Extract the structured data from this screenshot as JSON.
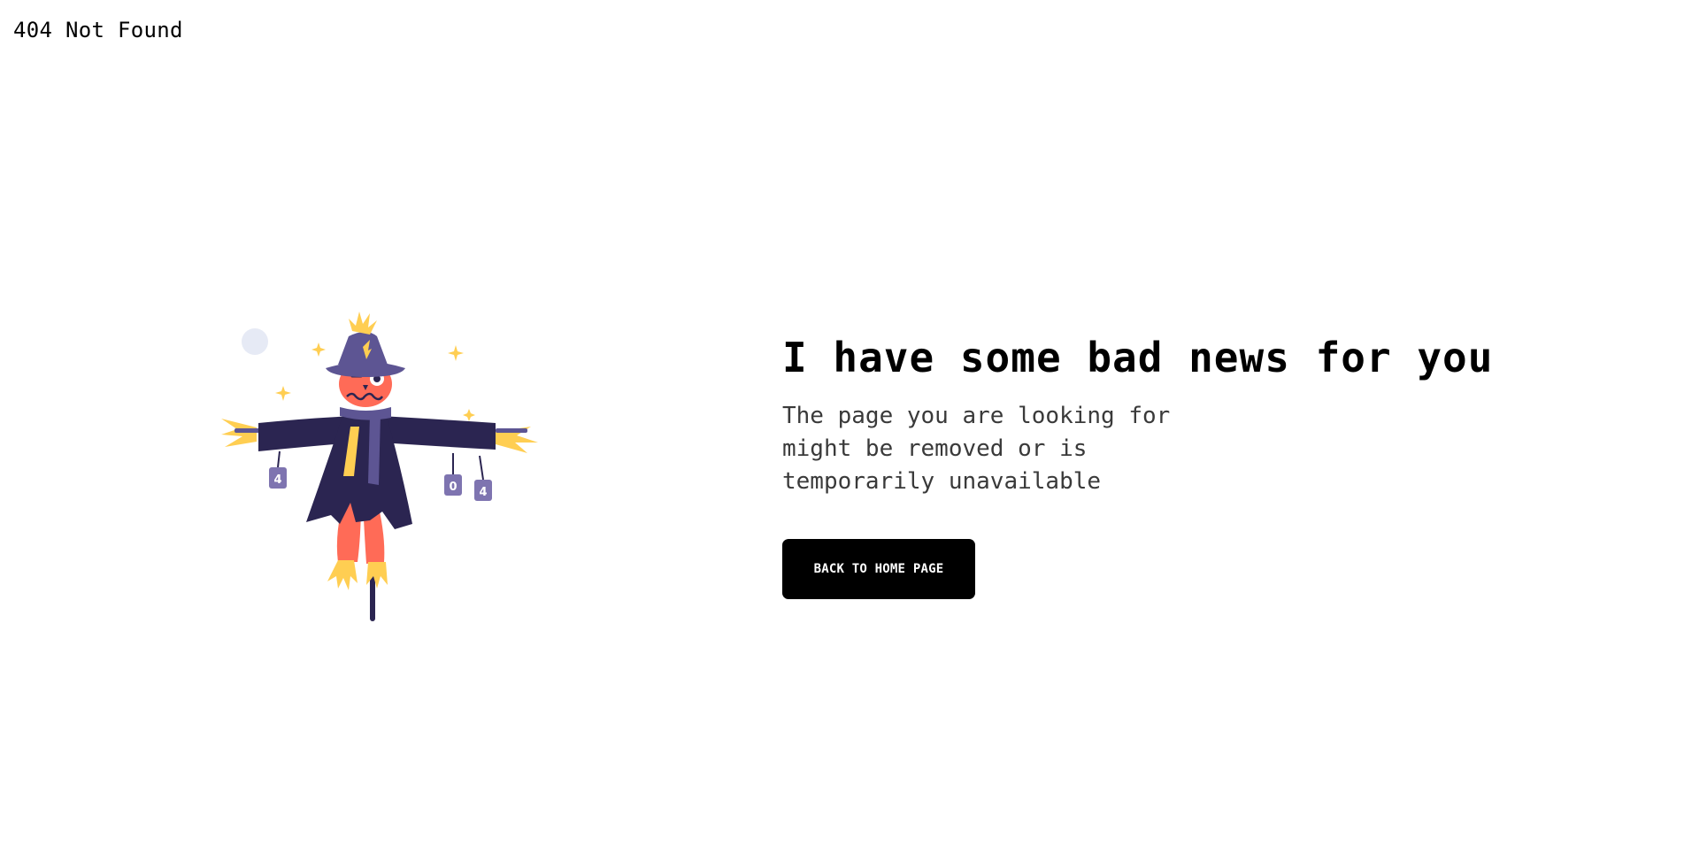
{
  "page": {
    "title": "404 Not Found"
  },
  "illustration": {
    "icon": "scarecrow-illustration",
    "can_labels": [
      "4",
      "0",
      "4"
    ]
  },
  "content": {
    "headline": "I have some bad news for you",
    "subtext": "The page you are looking for might be removed or is temporarily unavailable",
    "button_label": "BACK TO HOME PAGE"
  },
  "colors": {
    "background": "#ffffff",
    "text": "#000000",
    "button_bg": "#000000",
    "button_text": "#ffffff",
    "coat": "#2b2551",
    "hat": "#5d5593",
    "face": "#ff6b57",
    "straw": "#ffce52",
    "moon": "#e6eaf5"
  }
}
